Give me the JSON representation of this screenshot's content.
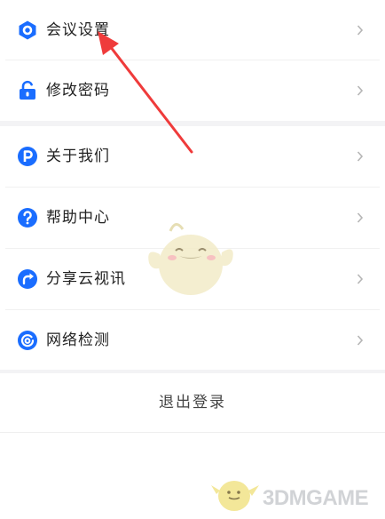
{
  "colors": {
    "accent": "#1a6dff",
    "arrow": "#ef3b3b",
    "text": "#222222",
    "chevron": "#b5b5b5",
    "separator": "#f3f3f5"
  },
  "menu": {
    "items": [
      {
        "label": "会议设置",
        "icon": "gear-hex-icon"
      },
      {
        "label": "修改密码",
        "icon": "lock-icon"
      },
      {
        "label": "关于我们",
        "icon": "p-circle-icon"
      },
      {
        "label": "帮助中心",
        "icon": "question-circle-icon"
      },
      {
        "label": "分享云视讯",
        "icon": "share-circle-icon"
      },
      {
        "label": "网络检测",
        "icon": "network-circle-icon"
      }
    ],
    "logout_label": "退出登录"
  },
  "watermark": {
    "text": "3DMGAME",
    "icon": "mascot-icon"
  }
}
